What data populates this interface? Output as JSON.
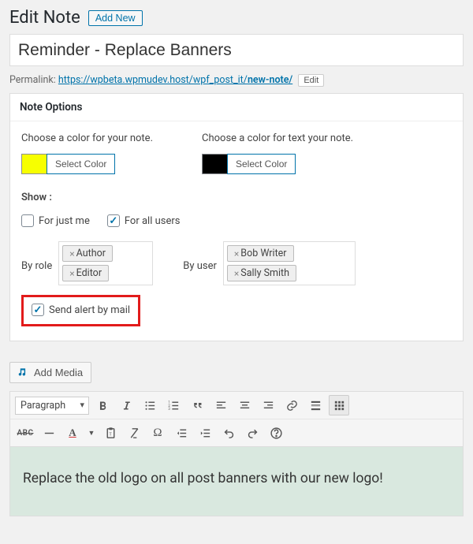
{
  "header": {
    "title": "Edit Note",
    "add_new": "Add New"
  },
  "form": {
    "title_value": "Reminder - Replace Banners"
  },
  "permalink": {
    "label": "Permalink:",
    "url_base": "https://wpbeta.wpmudev.host/wpf_post_it/",
    "url_slug": "new-note/",
    "edit_label": "Edit"
  },
  "options": {
    "heading": "Note Options",
    "color_bg": {
      "label": "Choose a color for your note.",
      "button": "Select Color",
      "hex": "#f7ff00"
    },
    "color_text": {
      "label": "Choose a color for text your note.",
      "button": "Select Color",
      "hex": "#000000"
    },
    "show_label": "Show :",
    "just_me": {
      "label": "For just me",
      "checked": false
    },
    "all_users": {
      "label": "For all users",
      "checked": true
    },
    "by_role": {
      "label": "By role",
      "tags": [
        "Author",
        "Editor"
      ]
    },
    "by_user": {
      "label": "By user",
      "tags": [
        "Bob Writer",
        "Sally Smith"
      ]
    },
    "send_mail": {
      "label": "Send alert by mail",
      "checked": true
    }
  },
  "editor": {
    "add_media": "Add Media",
    "paragraph_label": "Paragraph",
    "content": "Replace the old logo on all post banners with our new logo!"
  }
}
